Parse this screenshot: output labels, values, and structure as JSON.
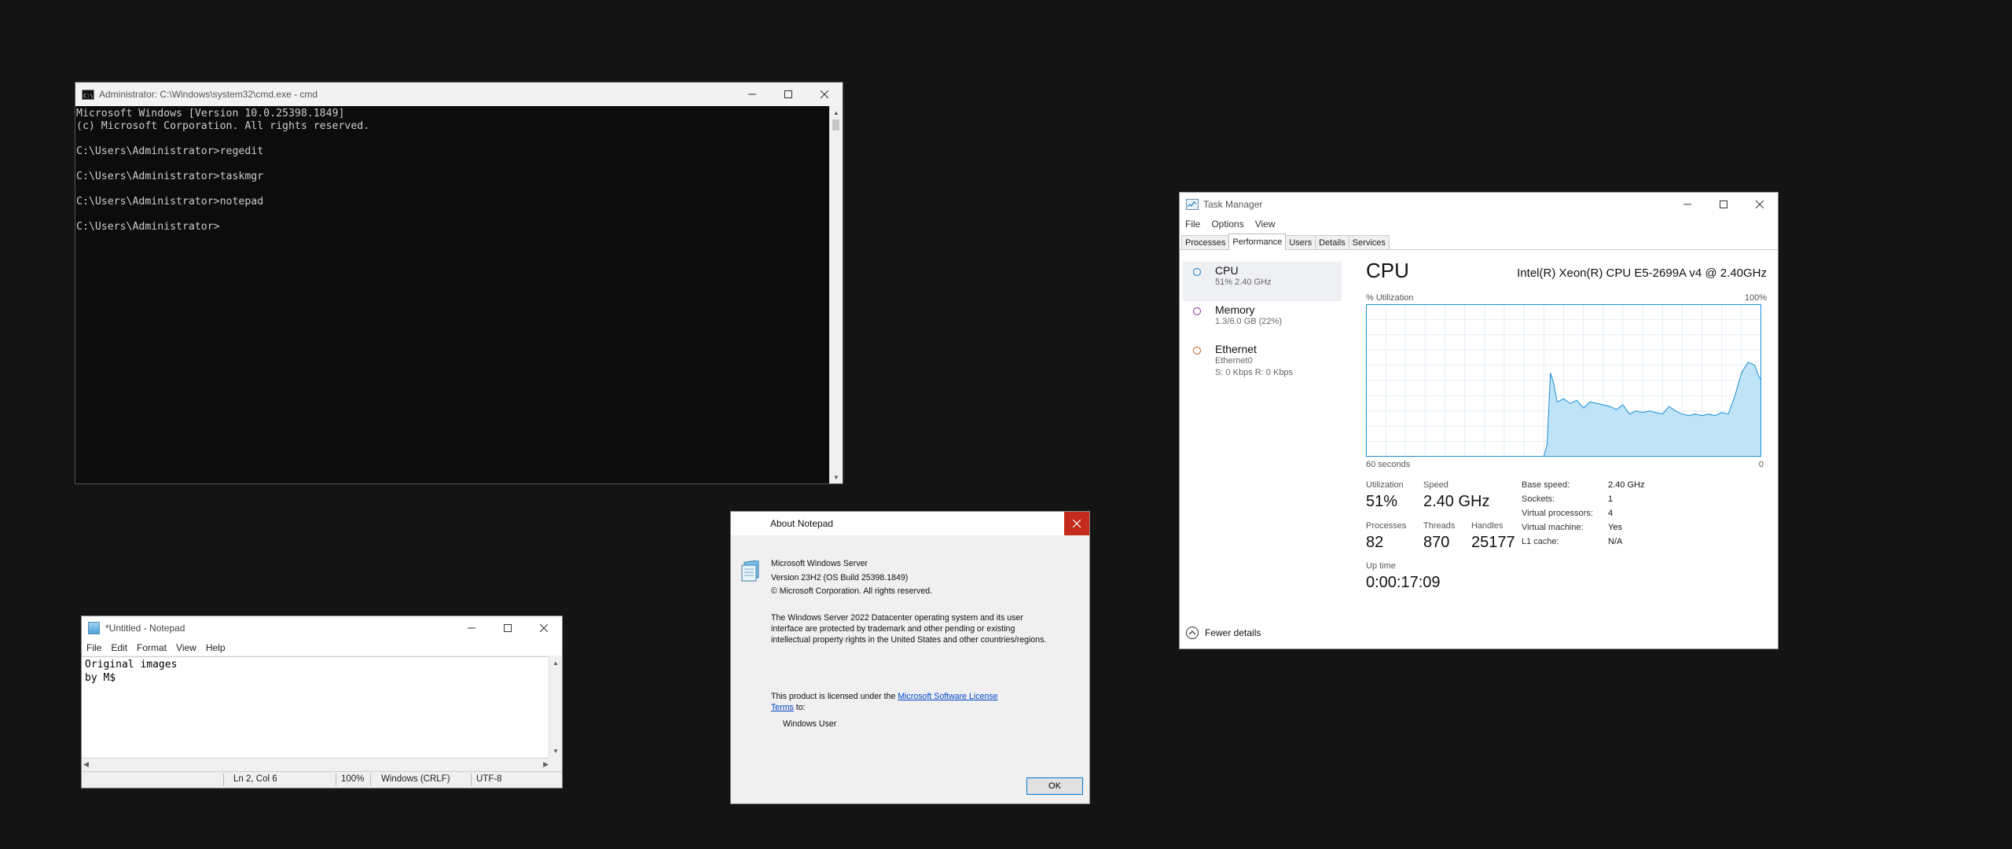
{
  "cmd": {
    "title": "Administrator: C:\\Windows\\system32\\cmd.exe - cmd",
    "lines": [
      "Microsoft Windows [Version 10.0.25398.1849]",
      "(c) Microsoft Corporation. All rights reserved.",
      "",
      "C:\\Users\\Administrator>regedit",
      "",
      "C:\\Users\\Administrator>taskmgr",
      "",
      "C:\\Users\\Administrator>notepad",
      "",
      "C:\\Users\\Administrator>"
    ]
  },
  "notepad": {
    "title": "*Untitled - Notepad",
    "menu": [
      "File",
      "Edit",
      "Format",
      "View",
      "Help"
    ],
    "text": "Original images\nby M$",
    "status": {
      "position": "Ln 2, Col 6",
      "zoom": "100%",
      "line_endings": "Windows (CRLF)",
      "encoding": "UTF-8"
    }
  },
  "about": {
    "title": "About Notepad",
    "product": "Microsoft Windows Server",
    "version": "Version 23H2 (OS Build 25398.1849)",
    "copyright": "© Microsoft Corporation. All rights reserved.",
    "legal_1": "The Windows Server 2022 Datacenter operating system and its user",
    "legal_2": "interface are protected by trademark and other pending or existing",
    "legal_3": "intellectual property rights in the United States and other countries/regions.",
    "license_pre": "This product is licensed under the ",
    "license_link_1": "Microsoft Software License",
    "license_link_2": "Terms",
    "license_post": " to:",
    "licensee": "Windows User",
    "ok_label": "OK"
  },
  "taskmgr": {
    "title": "Task Manager",
    "menu": [
      "File",
      "Options",
      "View"
    ],
    "tabs": [
      "Processes",
      "Performance",
      "Users",
      "Details",
      "Services"
    ],
    "active_tab": "Performance",
    "resources": [
      {
        "name": "CPU",
        "sub1": "51%  2.40 GHz",
        "sub2": "",
        "color": "#1a7fc7"
      },
      {
        "name": "Memory",
        "sub1": "1.3/6.0 GB (22%)",
        "sub2": "",
        "color": "#8b2ca0"
      },
      {
        "name": "Ethernet",
        "sub1": "Ethernet0",
        "sub2": "S: 0 Kbps  R: 0 Kbps",
        "color": "#c25e1a"
      }
    ],
    "cpu": {
      "heading": "CPU",
      "model": "Intel(R) Xeon(R) CPU E5-2699A v4 @ 2.40GHz",
      "util_label": "% Utilization",
      "max_label": "100%",
      "axis_left": "60 seconds",
      "axis_right": "0",
      "utilization_label": "Utilization",
      "utilization": "51%",
      "speed_label": "Speed",
      "speed": "2.40 GHz",
      "processes_label": "Processes",
      "processes": "82",
      "threads_label": "Threads",
      "threads": "870",
      "handles_label": "Handles",
      "handles": "25177",
      "uptime_label": "Up time",
      "uptime": "0:00:17:09",
      "details": [
        {
          "k": "Base speed:",
          "v": "2.40 GHz"
        },
        {
          "k": "Sockets:",
          "v": "1"
        },
        {
          "k": "Virtual processors:",
          "v": "4"
        },
        {
          "k": "Virtual machine:",
          "v": "Yes"
        },
        {
          "k": "L1 cache:",
          "v": "N/A"
        }
      ]
    },
    "fewer_details": "Fewer details"
  },
  "chart_data": {
    "type": "area",
    "title": "",
    "xlabel": "",
    "ylabel": "% Utilization",
    "xlim": [
      60,
      0
    ],
    "ylim": [
      0,
      100
    ],
    "x": [
      60,
      58,
      56,
      54,
      52,
      50,
      48,
      46,
      44,
      42,
      40,
      38,
      36,
      34,
      33,
      32.5,
      32,
      31.5,
      31,
      30,
      29,
      28,
      27,
      26,
      25,
      24,
      23,
      22,
      21,
      20,
      19,
      18,
      17,
      16,
      15,
      14,
      13,
      12,
      11,
      10,
      9,
      8,
      7,
      6,
      5,
      4,
      3,
      2,
      1,
      0.5,
      0
    ],
    "values": [
      0,
      0,
      0,
      0,
      0,
      0,
      0,
      0,
      0,
      0,
      0,
      0,
      0,
      0,
      0,
      8,
      55,
      48,
      36,
      38,
      35,
      37,
      32,
      36,
      35,
      34,
      33,
      31,
      34,
      28,
      30,
      29,
      30,
      29,
      28,
      33,
      30,
      28,
      27,
      28,
      27,
      28,
      27,
      29,
      28,
      40,
      55,
      62,
      60,
      54,
      50
    ],
    "grid": true,
    "colors": {
      "line": "#1b8fd6",
      "fill": "#bfe3f7",
      "grid": "#e4eef5",
      "border": "#1b8fd6"
    }
  }
}
